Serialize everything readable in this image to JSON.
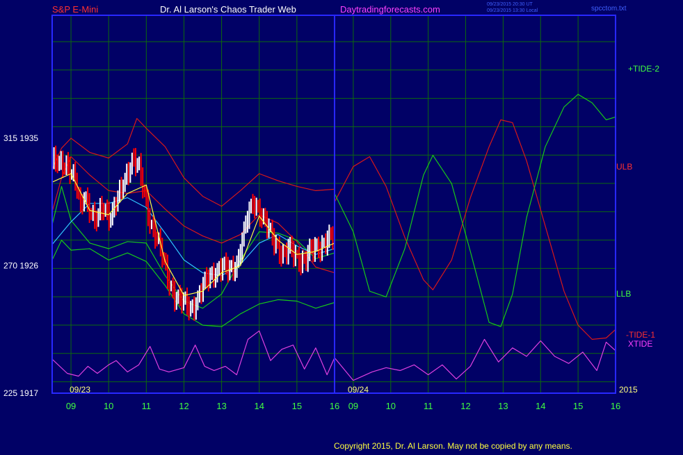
{
  "header": {
    "left": "S&P E-Mini",
    "center": "Dr. Al Larson's Chaos Trader Web",
    "site": "Daytradingforecasts.com",
    "stamp1": "09/23/2015 20:30 UT",
    "stamp2": "09/23/2015 13:30 Local",
    "file": "spcctom.txt"
  },
  "footer": "Copyright 2015, Dr. Al Larson. May not be copied by any means.",
  "colors": {
    "background": "#010166",
    "grid": "#0d6a0d",
    "frame": "#2828ff",
    "price_up": "#ffffff",
    "price_down": "#ff0000",
    "red_lines": "#d81818",
    "green_lines": "#18c818",
    "yellow_ma": "#ffff40",
    "cyan_ma": "#30c8ff",
    "xtide": "#e040e0",
    "title_red": "#ff3030",
    "title_pink": "#ff40ff",
    "axis_green": "#40ff40",
    "axis_yellow": "#ffff80"
  },
  "chart_data": {
    "type": "line",
    "title": "S&P E-Mini",
    "x_dates": [
      "09/23",
      "09/24"
    ],
    "year_label": "2015",
    "x_hours": [
      "09",
      "10",
      "11",
      "12",
      "13",
      "14",
      "15",
      "16",
      "09",
      "10",
      "11",
      "12",
      "13",
      "14",
      "15",
      "16"
    ],
    "x_range_hours": [
      8.5,
      16.0
    ],
    "y_ticks": [
      {
        "price": 1935,
        "count": 315
      },
      {
        "price": 1926,
        "count": 270
      },
      {
        "price": 1917,
        "count": 225
      }
    ],
    "ylim": [
      1917,
      1935
    ],
    "series_labels": {
      "plus_tide": "+TIDE-2",
      "ulb": "ULB",
      "llb": "LLB",
      "minus_tide": "-TIDE-1",
      "xtide": "XTIDE"
    },
    "price_close": [
      [
        8.5,
        1933.4
      ],
      [
        8.7,
        1933.0
      ],
      [
        8.9,
        1933.3
      ],
      [
        9.0,
        1932.8
      ],
      [
        9.15,
        1931.6
      ],
      [
        9.25,
        1929.8
      ],
      [
        9.35,
        1931.0
      ],
      [
        9.5,
        1930.2
      ],
      [
        9.65,
        1929.1
      ],
      [
        9.85,
        1930.0
      ],
      [
        10.05,
        1929.6
      ],
      [
        10.2,
        1930.5
      ],
      [
        10.35,
        1931.3
      ],
      [
        10.5,
        1932.6
      ],
      [
        10.65,
        1933.8
      ],
      [
        10.8,
        1932.9
      ],
      [
        10.95,
        1930.9
      ],
      [
        11.1,
        1929.2
      ],
      [
        11.25,
        1928.3
      ],
      [
        11.4,
        1926.9
      ],
      [
        11.55,
        1925.3
      ],
      [
        11.75,
        1924.0
      ],
      [
        12.0,
        1923.3
      ],
      [
        12.2,
        1923.0
      ],
      [
        12.4,
        1923.9
      ],
      [
        12.6,
        1924.9
      ],
      [
        12.8,
        1925.6
      ],
      [
        13.0,
        1925.9
      ],
      [
        13.2,
        1925.6
      ],
      [
        13.4,
        1926.2
      ],
      [
        13.55,
        1927.8
      ],
      [
        13.7,
        1929.4
      ],
      [
        13.85,
        1930.6
      ],
      [
        14.0,
        1930.0
      ],
      [
        14.15,
        1929.0
      ],
      [
        14.3,
        1928.2
      ],
      [
        14.5,
        1927.4
      ],
      [
        14.65,
        1926.7
      ],
      [
        14.8,
        1927.1
      ],
      [
        15.0,
        1926.7
      ],
      [
        15.2,
        1926.3
      ],
      [
        15.35,
        1926.9
      ],
      [
        15.5,
        1927.3
      ],
      [
        15.65,
        1927.5
      ],
      [
        15.8,
        1927.8
      ],
      [
        16.0,
        1927.9
      ]
    ],
    "ulb": [
      [
        8.5,
        1932.8
      ],
      [
        8.75,
        1934.3
      ],
      [
        9.0,
        1935.0
      ],
      [
        9.5,
        1934.0
      ],
      [
        10.0,
        1933.6
      ],
      [
        10.5,
        1934.6
      ],
      [
        10.75,
        1936.4
      ],
      [
        11.0,
        1935.7
      ],
      [
        11.5,
        1934.4
      ],
      [
        12.0,
        1932.2
      ],
      [
        12.5,
        1930.9
      ],
      [
        13.0,
        1930.2
      ],
      [
        13.5,
        1931.3
      ],
      [
        14.0,
        1932.5
      ],
      [
        14.5,
        1932.0
      ],
      [
        15.0,
        1931.6
      ],
      [
        15.5,
        1931.3
      ],
      [
        16.0,
        1931.4
      ]
    ],
    "llb": [
      [
        8.5,
        1926.4
      ],
      [
        8.75,
        1927.8
      ],
      [
        9.0,
        1927.1
      ],
      [
        9.5,
        1927.2
      ],
      [
        10.0,
        1926.4
      ],
      [
        10.5,
        1926.9
      ],
      [
        11.0,
        1926.3
      ],
      [
        11.5,
        1924.6
      ],
      [
        12.0,
        1922.6
      ],
      [
        12.5,
        1921.8
      ],
      [
        13.0,
        1921.7
      ],
      [
        13.5,
        1922.6
      ],
      [
        14.0,
        1923.3
      ],
      [
        14.5,
        1923.6
      ],
      [
        15.0,
        1923.5
      ],
      [
        15.5,
        1923.0
      ],
      [
        16.0,
        1923.4
      ]
    ],
    "upper_band": [
      [
        8.5,
        1929.8
      ],
      [
        8.75,
        1932.2
      ],
      [
        9.0,
        1933.7
      ],
      [
        9.5,
        1932.4
      ],
      [
        10.0,
        1931.3
      ],
      [
        10.5,
        1931.1
      ],
      [
        11.0,
        1931.3
      ],
      [
        11.5,
        1930.0
      ],
      [
        12.0,
        1928.8
      ],
      [
        12.5,
        1928.1
      ],
      [
        13.0,
        1927.6
      ],
      [
        13.5,
        1928.2
      ],
      [
        14.0,
        1929.6
      ],
      [
        14.5,
        1929.0
      ],
      [
        15.0,
        1927.7
      ],
      [
        15.5,
        1925.9
      ],
      [
        16.0,
        1925.5
      ]
    ],
    "lower_band": [
      [
        8.5,
        1928.9
      ],
      [
        8.75,
        1931.6
      ],
      [
        9.0,
        1929.2
      ],
      [
        9.5,
        1927.6
      ],
      [
        10.0,
        1927.2
      ],
      [
        10.5,
        1927.7
      ],
      [
        11.0,
        1927.6
      ],
      [
        11.5,
        1925.3
      ],
      [
        12.0,
        1923.5
      ],
      [
        12.5,
        1923.0
      ],
      [
        13.0,
        1924.0
      ],
      [
        13.5,
        1926.4
      ],
      [
        14.0,
        1928.4
      ],
      [
        14.5,
        1928.3
      ],
      [
        15.0,
        1927.8
      ],
      [
        15.5,
        1926.5
      ],
      [
        16.0,
        1926.9
      ]
    ],
    "cyan_ma": [
      [
        8.5,
        1927.5
      ],
      [
        9.0,
        1929.1
      ],
      [
        9.5,
        1930.4
      ],
      [
        10.0,
        1930.4
      ],
      [
        10.5,
        1930.8
      ],
      [
        11.0,
        1930.1
      ],
      [
        11.5,
        1928.3
      ],
      [
        12.0,
        1926.4
      ],
      [
        12.5,
        1925.5
      ],
      [
        13.0,
        1925.3
      ],
      [
        13.5,
        1926.1
      ],
      [
        14.0,
        1927.6
      ],
      [
        14.5,
        1928.2
      ],
      [
        15.0,
        1927.4
      ],
      [
        15.5,
        1926.8
      ],
      [
        16.0,
        1927.2
      ]
    ],
    "yellow_ma": [
      [
        8.5,
        1931.9
      ],
      [
        9.0,
        1932.5
      ],
      [
        9.5,
        1929.9
      ],
      [
        10.0,
        1929.6
      ],
      [
        10.5,
        1931.1
      ],
      [
        11.0,
        1931.7
      ],
      [
        11.5,
        1926.3
      ],
      [
        12.0,
        1923.9
      ],
      [
        12.5,
        1924.2
      ],
      [
        13.0,
        1925.5
      ],
      [
        13.5,
        1926.0
      ],
      [
        14.0,
        1929.5
      ],
      [
        14.5,
        1927.8
      ],
      [
        15.0,
        1926.8
      ],
      [
        15.5,
        1927.0
      ],
      [
        16.0,
        1927.6
      ]
    ],
    "forecast_minus_tide_red": [
      [
        16.0,
        1930.5
      ],
      [
        16.4,
        1933.0
      ],
      [
        16.75,
        1933.7
      ],
      [
        17.1,
        1931.6
      ],
      [
        17.5,
        1928.0
      ],
      [
        17.9,
        1925.0
      ],
      [
        18.1,
        1924.3
      ],
      [
        18.5,
        1926.4
      ],
      [
        18.9,
        1930.8
      ],
      [
        19.3,
        1934.4
      ],
      [
        19.55,
        1936.3
      ],
      [
        19.8,
        1936.1
      ],
      [
        20.1,
        1933.4
      ],
      [
        20.5,
        1928.8
      ],
      [
        20.9,
        1924.2
      ],
      [
        21.2,
        1921.8
      ],
      [
        21.5,
        1920.8
      ],
      [
        21.8,
        1920.9
      ],
      [
        22.0,
        1921.5
      ]
    ],
    "forecast_plus_tide_green": [
      [
        16.0,
        1931.1
      ],
      [
        16.4,
        1928.4
      ],
      [
        16.75,
        1924.2
      ],
      [
        17.1,
        1923.8
      ],
      [
        17.5,
        1927.2
      ],
      [
        17.9,
        1932.4
      ],
      [
        18.1,
        1933.8
      ],
      [
        18.5,
        1931.8
      ],
      [
        18.9,
        1927.0
      ],
      [
        19.3,
        1922.0
      ],
      [
        19.55,
        1921.7
      ],
      [
        19.8,
        1924.0
      ],
      [
        20.1,
        1929.4
      ],
      [
        20.5,
        1934.4
      ],
      [
        20.9,
        1937.2
      ],
      [
        21.2,
        1938.1
      ],
      [
        21.5,
        1937.5
      ],
      [
        21.8,
        1936.3
      ],
      [
        22.0,
        1936.5
      ]
    ],
    "xtide": [
      [
        8.5,
        1919.4
      ],
      [
        8.9,
        1918.4
      ],
      [
        9.2,
        1918.2
      ],
      [
        9.45,
        1918.9
      ],
      [
        9.7,
        1918.4
      ],
      [
        10.0,
        1919.0
      ],
      [
        10.2,
        1919.3
      ],
      [
        10.5,
        1918.5
      ],
      [
        10.8,
        1919.0
      ],
      [
        11.1,
        1920.3
      ],
      [
        11.35,
        1918.7
      ],
      [
        11.6,
        1918.5
      ],
      [
        12.0,
        1918.8
      ],
      [
        12.3,
        1920.4
      ],
      [
        12.55,
        1918.9
      ],
      [
        12.8,
        1918.6
      ],
      [
        13.1,
        1918.9
      ],
      [
        13.4,
        1918.3
      ],
      [
        13.7,
        1920.8
      ],
      [
        14.0,
        1921.4
      ],
      [
        14.3,
        1919.3
      ],
      [
        14.6,
        1920.1
      ],
      [
        14.9,
        1920.4
      ],
      [
        15.2,
        1918.7
      ],
      [
        15.5,
        1920.2
      ],
      [
        15.8,
        1918.3
      ],
      [
        16.0,
        1919.5
      ],
      [
        16.4,
        1917.9
      ],
      [
        16.8,
        1918.5
      ],
      [
        17.1,
        1918.8
      ],
      [
        17.4,
        1918.6
      ],
      [
        17.7,
        1919.0
      ],
      [
        18.0,
        1918.3
      ],
      [
        18.3,
        1919.0
      ],
      [
        18.6,
        1918.0
      ],
      [
        18.9,
        1918.9
      ],
      [
        19.2,
        1920.8
      ],
      [
        19.5,
        1919.2
      ],
      [
        19.8,
        1920.2
      ],
      [
        20.1,
        1919.6
      ],
      [
        20.4,
        1920.7
      ],
      [
        20.7,
        1919.6
      ],
      [
        21.0,
        1919.1
      ],
      [
        21.3,
        1919.9
      ],
      [
        21.6,
        1918.6
      ],
      [
        21.8,
        1920.6
      ],
      [
        22.0,
        1920.0
      ]
    ]
  }
}
